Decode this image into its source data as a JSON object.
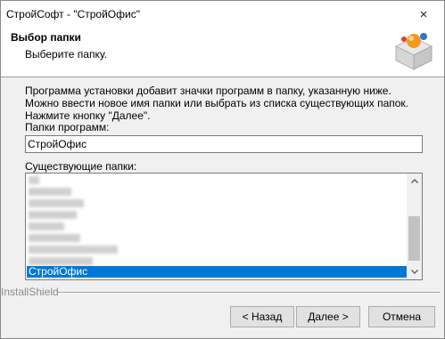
{
  "window": {
    "title": "СтройСофт - \"СтройОфис\"",
    "close_icon": "×"
  },
  "header": {
    "title": "Выбор папки",
    "subtitle": "Выберите папку."
  },
  "body": {
    "description": "Программа установки добавит значки программ в папку, указанную ниже.  Можно ввести новое имя папки или выбрать из списка существующих папок.  Нажмите кнопку \"Далее\".",
    "programs_label": "Папки программ:",
    "folder_value": "СтройОфис",
    "existing_label": "Существующие папки:",
    "list": {
      "selected_item": "СтройОфис"
    }
  },
  "footer": {
    "brand": "InstallShield",
    "buttons": {
      "back": "< Назад",
      "next": "Далее >",
      "cancel": "Отмена"
    }
  },
  "colors": {
    "selection": "#0078d7",
    "window_bg": "#f0f0f0",
    "header_bg": "#ffffff"
  },
  "icons": {
    "logo": "installer-box-icon",
    "scroll_up": "chevron-up-icon",
    "scroll_down": "chevron-down-icon"
  }
}
